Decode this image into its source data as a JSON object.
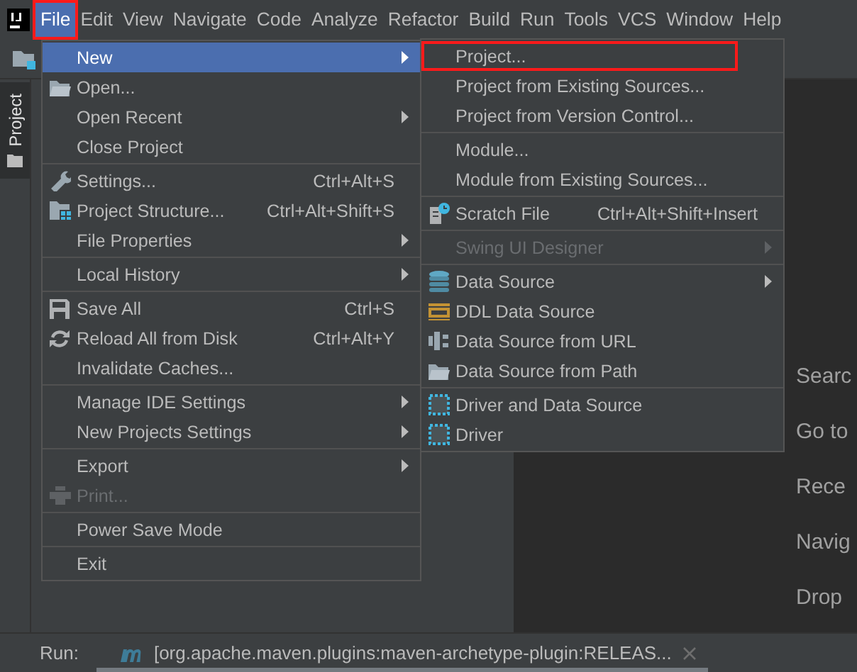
{
  "menu_bar": [
    {
      "label": "File",
      "selected": true,
      "highlighted": true
    },
    {
      "label": "Edit",
      "selected": false,
      "highlighted": false
    },
    {
      "label": "View",
      "selected": false,
      "highlighted": false
    },
    {
      "label": "Navigate",
      "selected": false,
      "highlighted": false
    },
    {
      "label": "Code",
      "selected": false,
      "highlighted": false
    },
    {
      "label": "Analyze",
      "selected": false,
      "highlighted": false
    },
    {
      "label": "Refactor",
      "selected": false,
      "highlighted": false
    },
    {
      "label": "Build",
      "selected": false,
      "highlighted": false
    },
    {
      "label": "Run",
      "selected": false,
      "highlighted": false
    },
    {
      "label": "Tools",
      "selected": false,
      "highlighted": false
    },
    {
      "label": "VCS",
      "selected": false,
      "highlighted": false
    },
    {
      "label": "Window",
      "selected": false,
      "highlighted": false
    },
    {
      "label": "Help",
      "selected": false,
      "highlighted": false
    }
  ],
  "tool_window_tabs": [
    {
      "label": "Project",
      "selected": true
    }
  ],
  "file_menu": [
    {
      "kind": "item",
      "label": "New",
      "has_submenu": true,
      "selected": true,
      "disabled": false
    },
    {
      "kind": "item",
      "label": "Open...",
      "has_submenu": false,
      "selected": false,
      "disabled": false
    },
    {
      "kind": "item",
      "label": "Open Recent",
      "has_submenu": true,
      "selected": false,
      "disabled": false
    },
    {
      "kind": "item",
      "label": "Close Project",
      "has_submenu": false,
      "selected": false,
      "disabled": false
    },
    {
      "kind": "separator"
    },
    {
      "kind": "item",
      "label": "Settings...",
      "shortcut": "Ctrl+Alt+S",
      "has_submenu": false,
      "selected": false,
      "disabled": false
    },
    {
      "kind": "item",
      "label": "Project Structure...",
      "shortcut": "Ctrl+Alt+Shift+S",
      "has_submenu": false,
      "selected": false,
      "disabled": false
    },
    {
      "kind": "item",
      "label": "File Properties",
      "has_submenu": true,
      "selected": false,
      "disabled": false
    },
    {
      "kind": "separator"
    },
    {
      "kind": "item",
      "label": "Local History",
      "has_submenu": true,
      "selected": false,
      "disabled": false
    },
    {
      "kind": "separator"
    },
    {
      "kind": "item",
      "label": "Save All",
      "shortcut": "Ctrl+S",
      "has_submenu": false,
      "selected": false,
      "disabled": false
    },
    {
      "kind": "item",
      "label": "Reload All from Disk",
      "shortcut": "Ctrl+Alt+Y",
      "has_submenu": false,
      "selected": false,
      "disabled": false
    },
    {
      "kind": "item",
      "label": "Invalidate Caches...",
      "has_submenu": false,
      "selected": false,
      "disabled": false
    },
    {
      "kind": "separator"
    },
    {
      "kind": "item",
      "label": "Manage IDE Settings",
      "has_submenu": true,
      "selected": false,
      "disabled": false
    },
    {
      "kind": "item",
      "label": "New Projects Settings",
      "has_submenu": true,
      "selected": false,
      "disabled": false
    },
    {
      "kind": "separator"
    },
    {
      "kind": "item",
      "label": "Export",
      "has_submenu": true,
      "selected": false,
      "disabled": false
    },
    {
      "kind": "item",
      "label": "Print...",
      "has_submenu": false,
      "selected": false,
      "disabled": true
    },
    {
      "kind": "separator"
    },
    {
      "kind": "item",
      "label": "Power Save Mode",
      "has_submenu": false,
      "selected": false,
      "disabled": false
    },
    {
      "kind": "separator"
    },
    {
      "kind": "item",
      "label": "Exit",
      "has_submenu": false,
      "selected": false,
      "disabled": false
    }
  ],
  "new_submenu": [
    {
      "kind": "item",
      "label": "Project...",
      "has_submenu": false,
      "selected": false,
      "disabled": false,
      "highlighted": true
    },
    {
      "kind": "item",
      "label": "Project from Existing Sources...",
      "has_submenu": false,
      "selected": false,
      "disabled": false,
      "highlighted": false
    },
    {
      "kind": "item",
      "label": "Project from Version Control...",
      "has_submenu": false,
      "selected": false,
      "disabled": false,
      "highlighted": false
    },
    {
      "kind": "separator"
    },
    {
      "kind": "item",
      "label": "Module...",
      "has_submenu": false,
      "selected": false,
      "disabled": false,
      "highlighted": false
    },
    {
      "kind": "item",
      "label": "Module from Existing Sources...",
      "has_submenu": false,
      "selected": false,
      "disabled": false,
      "highlighted": false
    },
    {
      "kind": "separator"
    },
    {
      "kind": "item",
      "label": "Scratch File",
      "shortcut": "Ctrl+Alt+Shift+Insert",
      "has_submenu": false,
      "selected": false,
      "disabled": false,
      "highlighted": false
    },
    {
      "kind": "separator"
    },
    {
      "kind": "item",
      "label": "Swing UI Designer",
      "has_submenu": true,
      "selected": false,
      "disabled": true,
      "highlighted": false
    },
    {
      "kind": "separator"
    },
    {
      "kind": "item",
      "label": "Data Source",
      "has_submenu": true,
      "selected": false,
      "disabled": false,
      "highlighted": false
    },
    {
      "kind": "item",
      "label": "DDL Data Source",
      "has_submenu": false,
      "selected": false,
      "disabled": false,
      "highlighted": false
    },
    {
      "kind": "item",
      "label": "Data Source from URL",
      "has_submenu": false,
      "selected": false,
      "disabled": false,
      "highlighted": false
    },
    {
      "kind": "item",
      "label": "Data Source from Path",
      "has_submenu": false,
      "selected": false,
      "disabled": false,
      "highlighted": false
    },
    {
      "kind": "separator"
    },
    {
      "kind": "item",
      "label": "Driver and Data Source",
      "has_submenu": false,
      "selected": false,
      "disabled": false,
      "highlighted": false
    },
    {
      "kind": "item",
      "label": "Driver",
      "has_submenu": false,
      "selected": false,
      "disabled": false,
      "highlighted": false
    }
  ],
  "editor_hints": [
    "Searc",
    "Go to",
    "Rece",
    "Navig",
    "Drop"
  ],
  "run_bar": {
    "label": "Run:",
    "tabs": [
      {
        "label": "[org.apache.maven.plugins:maven-archetype-plugin:RELEAS...",
        "selected": true
      }
    ]
  }
}
